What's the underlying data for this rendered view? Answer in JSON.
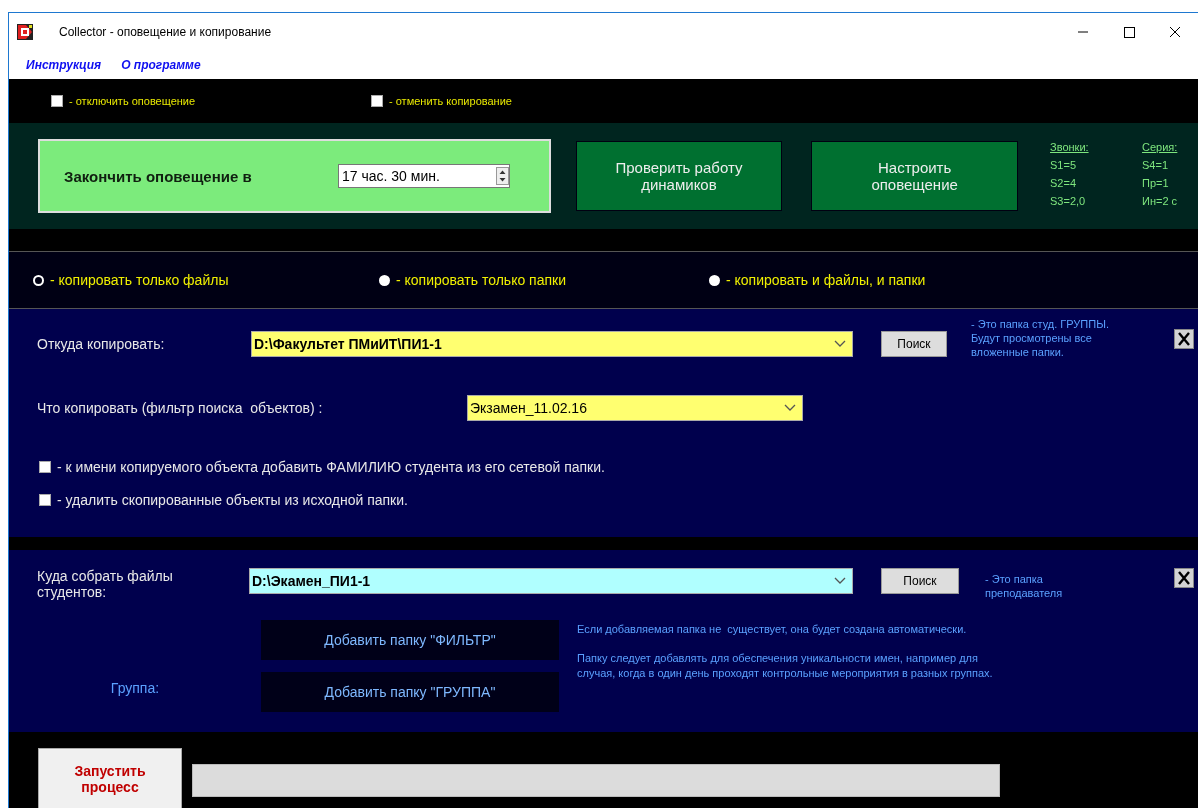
{
  "window": {
    "title": "Collector - оповещение и копирование"
  },
  "menu": [
    {
      "label": "Инструкция"
    },
    {
      "label": "О программе"
    }
  ],
  "toggles": [
    {
      "label": "- отключить оповещение",
      "checked": false
    },
    {
      "label": "- отменить копирование",
      "checked": false
    }
  ],
  "alert_end": {
    "label": "Закончить оповещение в",
    "value": "17 час. 30 мин."
  },
  "alert_buttons": [
    "Проверить работу динамиков",
    "Настроить оповещение"
  ],
  "stats": [
    {
      "heading": "Звонки:",
      "lines": [
        "S1=5",
        "S2=4",
        "S3=2,0"
      ]
    },
    {
      "heading": "Серия:",
      "lines": [
        "S4=1",
        "Пр=1",
        "Ин=2 с"
      ]
    }
  ],
  "copy_modes": [
    {
      "label": "- копировать только файлы",
      "selected": true
    },
    {
      "label": "- копировать только папки",
      "selected": false
    },
    {
      "label": "- копировать и файлы, и папки",
      "selected": false
    }
  ],
  "source": {
    "label": "Откуда копировать:",
    "value": "D:\\Факультет ПМиИТ\\ПИ1-1",
    "search": "Поиск",
    "note": "- Это папка студ. ГРУППЫ.\n  Будут просмотрены все\n  вложенные папки."
  },
  "filter": {
    "label": "Что копировать (фильтр поиска  объектов) :",
    "value": "Экзамен_11.02.16"
  },
  "options": [
    {
      "label": "- к имени копируемого объекта добавить ФАМИЛИЮ студента из его сетевой папки.",
      "checked": false
    },
    {
      "label": "- удалить скопированные объекты из исходной папки.",
      "checked": false
    }
  ],
  "target": {
    "label": "Куда собрать файлы студентов:",
    "value": "D:\\Экамен_ПИ1-1",
    "search": "Поиск",
    "note": "- Это папка\n   преподавателя"
  },
  "add_buttons": [
    "Добавить папку \"ФИЛЬТР\"",
    "Добавить папку \"ГРУППА\""
  ],
  "group_label": "Группа:",
  "info": [
    "Если добавляемая папка не  существует, она будет создана автоматически.",
    "Папку следует добавлять для обеспечения уникальности имен, например для случая, когда в один день проходят контрольные мероприятия в разных группах."
  ],
  "start_button": "Запустить процесс",
  "progress": {
    "level": 0
  }
}
